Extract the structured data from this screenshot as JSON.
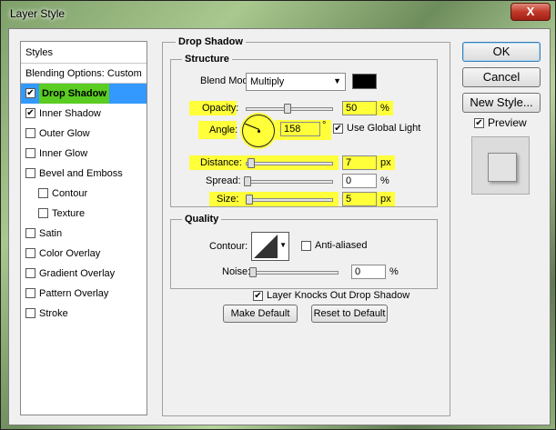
{
  "window": {
    "title": "Layer Style",
    "close_glyph": "X"
  },
  "styles_panel": {
    "header": "Styles",
    "blending": "Blending Options: Custom",
    "items": [
      {
        "label": "Drop Shadow",
        "checked": true,
        "selected": true
      },
      {
        "label": "Inner Shadow",
        "checked": true
      },
      {
        "label": "Outer Glow",
        "checked": false
      },
      {
        "label": "Inner Glow",
        "checked": false
      },
      {
        "label": "Bevel and Emboss",
        "checked": false
      },
      {
        "label": "Contour",
        "checked": false,
        "sub": true
      },
      {
        "label": "Texture",
        "checked": false,
        "sub": true
      },
      {
        "label": "Satin",
        "checked": false
      },
      {
        "label": "Color Overlay",
        "checked": false
      },
      {
        "label": "Gradient Overlay",
        "checked": false
      },
      {
        "label": "Pattern Overlay",
        "checked": false
      },
      {
        "label": "Stroke",
        "checked": false
      }
    ]
  },
  "drop_shadow": {
    "title": "Drop Shadow",
    "structure": {
      "title": "Structure",
      "blend_mode_label": "Blend Mode:",
      "blend_mode_value": "Multiply",
      "shadow_color": "#000000",
      "opacity_label": "Opacity:",
      "opacity_value": "50",
      "opacity_unit": "%",
      "angle_label": "Angle:",
      "angle_value": "158",
      "angle_unit": "°",
      "use_global_light": "Use Global Light",
      "distance_label": "Distance:",
      "distance_value": "7",
      "distance_unit": "px",
      "spread_label": "Spread:",
      "spread_value": "0",
      "spread_unit": "%",
      "size_label": "Size:",
      "size_value": "5",
      "size_unit": "px"
    },
    "quality": {
      "title": "Quality",
      "contour_label": "Contour:",
      "anti_aliased": "Anti-aliased",
      "noise_label": "Noise:",
      "noise_value": "0",
      "noise_unit": "%"
    },
    "knocks_out": "Layer Knocks Out Drop Shadow",
    "make_default": "Make Default",
    "reset_default": "Reset to Default"
  },
  "buttons": {
    "ok": "OK",
    "cancel": "Cancel",
    "new_style": "New Style...",
    "preview": "Preview"
  },
  "colors": {
    "highlight": "#ffff3a",
    "selected_row": "#3399ff",
    "drop_shadow_highlight": "#5acc22"
  }
}
